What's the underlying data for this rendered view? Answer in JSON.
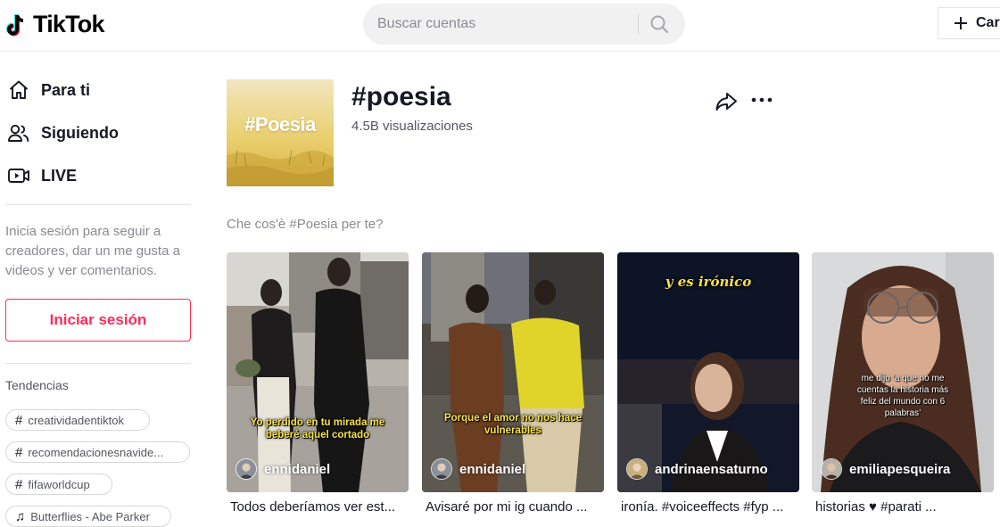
{
  "header": {
    "logo_text": "TikTok",
    "search_placeholder": "Buscar cuentas",
    "upload_label": "Car"
  },
  "sidebar": {
    "nav": [
      {
        "label": "Para ti",
        "icon": "home-icon"
      },
      {
        "label": "Siguiendo",
        "icon": "following-icon"
      },
      {
        "label": "LIVE",
        "icon": "live-icon"
      }
    ],
    "login_prompt": "Inicia sesión para seguir a creadores, dar un me gusta a videos y ver comentarios.",
    "login_button": "Iniciar sesión",
    "trending_title": "Tendencias",
    "trending": [
      {
        "label": "creatividadentiktok",
        "icon": "hashtag-icon"
      },
      {
        "label": "recomendacionesnavide...",
        "icon": "hashtag-icon"
      },
      {
        "label": "fifaworldcup",
        "icon": "hashtag-icon"
      },
      {
        "label": "Butterflies - Abe Parker",
        "icon": "music-note-icon"
      }
    ]
  },
  "tag": {
    "cover_text": "#Poesia",
    "title": "#poesia",
    "views": "4.5B visualizaciones",
    "suggestion": "Che cos'è #Poesia per te?"
  },
  "videos": [
    {
      "overlay": "Yo perdido en tu mirada me beberé aquel cortado",
      "username": "ennidaniel",
      "caption": "Todos deberíamos ver est..."
    },
    {
      "overlay": "Porque el amor no nos hace vulnerables",
      "username": "ennidaniel",
      "caption": "Avisaré por mi ig cuando ..."
    },
    {
      "overlay": "y es irónico",
      "username": "andrinaensaturno",
      "caption": "ironía. #voiceeffects #fyp ..."
    },
    {
      "overlay": "me dijo ‘a que no me cuentas la historia más feliz del mundo con 6 palabras’",
      "username": "emiliapesqueira",
      "caption": "historias ♥ #parati ..."
    }
  ],
  "colors": {
    "brand_red": "#fe2c55",
    "text_primary": "#161823",
    "text_muted": "#8a8b91",
    "overlay_yellow": "#f7e34a"
  }
}
